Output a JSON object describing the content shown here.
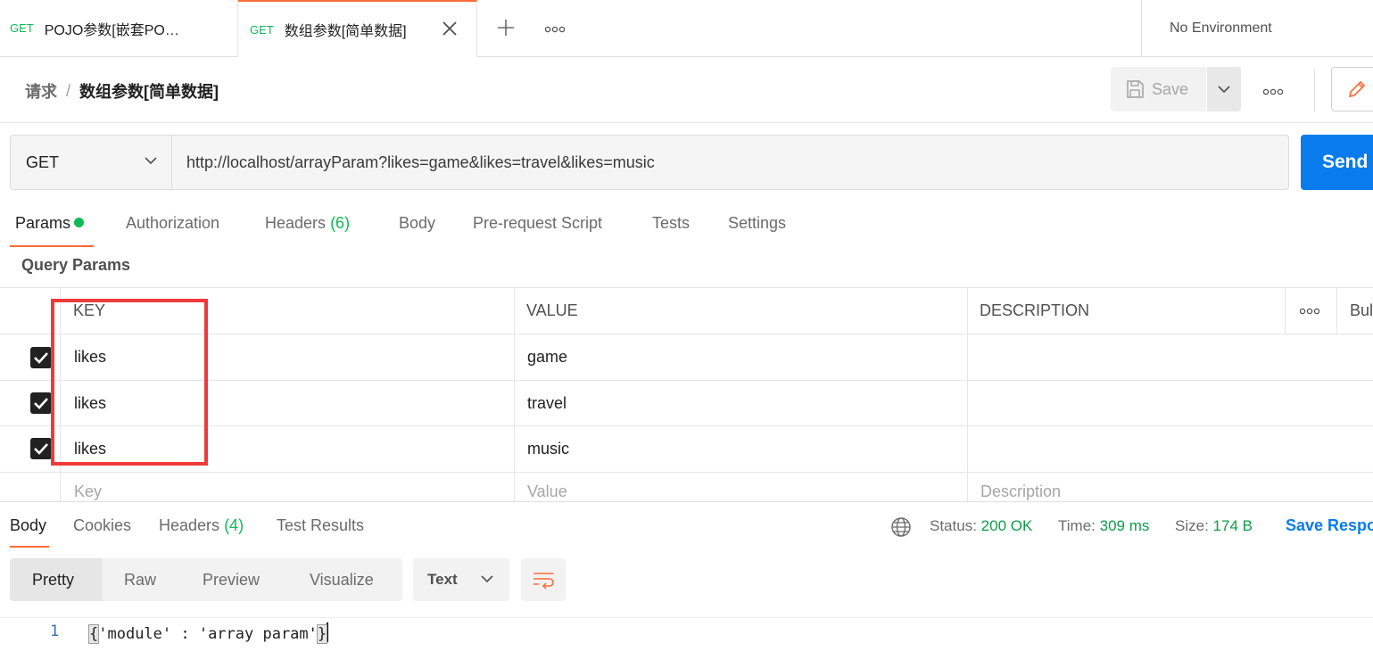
{
  "tabs": [
    {
      "method": "GET",
      "title": "POJO参数[嵌套PO…",
      "active": false
    },
    {
      "method": "GET",
      "title": "数组参数[简单数据]",
      "active": true
    }
  ],
  "environment": "No Environment",
  "breadcrumb": {
    "parent": "请求",
    "separator": "/",
    "current": "数组参数[简单数据]"
  },
  "toolbar": {
    "save_label": "Save"
  },
  "request": {
    "method": "GET",
    "url": "http://localhost/arrayParam?likes=game&likes=travel&likes=music",
    "send_label": "Send"
  },
  "request_tabs": [
    {
      "label": "Params",
      "count": "",
      "active": true
    },
    {
      "label": "Authorization",
      "count": ""
    },
    {
      "label": "Headers",
      "count": "(6)"
    },
    {
      "label": "Body",
      "count": ""
    },
    {
      "label": "Pre-request Script",
      "count": ""
    },
    {
      "label": "Tests",
      "count": ""
    },
    {
      "label": "Settings",
      "count": ""
    }
  ],
  "query_params": {
    "title": "Query Params",
    "columns": [
      "KEY",
      "VALUE",
      "DESCRIPTION",
      "Bul"
    ],
    "rows": [
      {
        "checked": true,
        "key": "likes",
        "value": "game",
        "description": ""
      },
      {
        "checked": true,
        "key": "likes",
        "value": "travel",
        "description": ""
      },
      {
        "checked": true,
        "key": "likes",
        "value": "music",
        "description": ""
      }
    ],
    "placeholders": {
      "key": "Key",
      "value": "Value",
      "description": "Description"
    }
  },
  "response": {
    "tabs": [
      {
        "label": "Body",
        "count": "",
        "active": true
      },
      {
        "label": "Cookies",
        "count": ""
      },
      {
        "label": "Headers",
        "count": "(4)"
      },
      {
        "label": "Test Results",
        "count": ""
      }
    ],
    "status_label": "Status:",
    "status": "200 OK",
    "time_label": "Time:",
    "time": "309 ms",
    "size_label": "Size:",
    "size": "174 B",
    "save_label": "Save Respo",
    "views": [
      "Pretty",
      "Raw",
      "Preview",
      "Visualize"
    ],
    "format": "Text",
    "lines": [
      {
        "number": "1",
        "text": "'module' : 'array param'"
      }
    ]
  },
  "colors": {
    "accent": "#ff6c37",
    "send": "#097bed",
    "success": "#0cbb52",
    "highlight": "#ef3a3a"
  }
}
